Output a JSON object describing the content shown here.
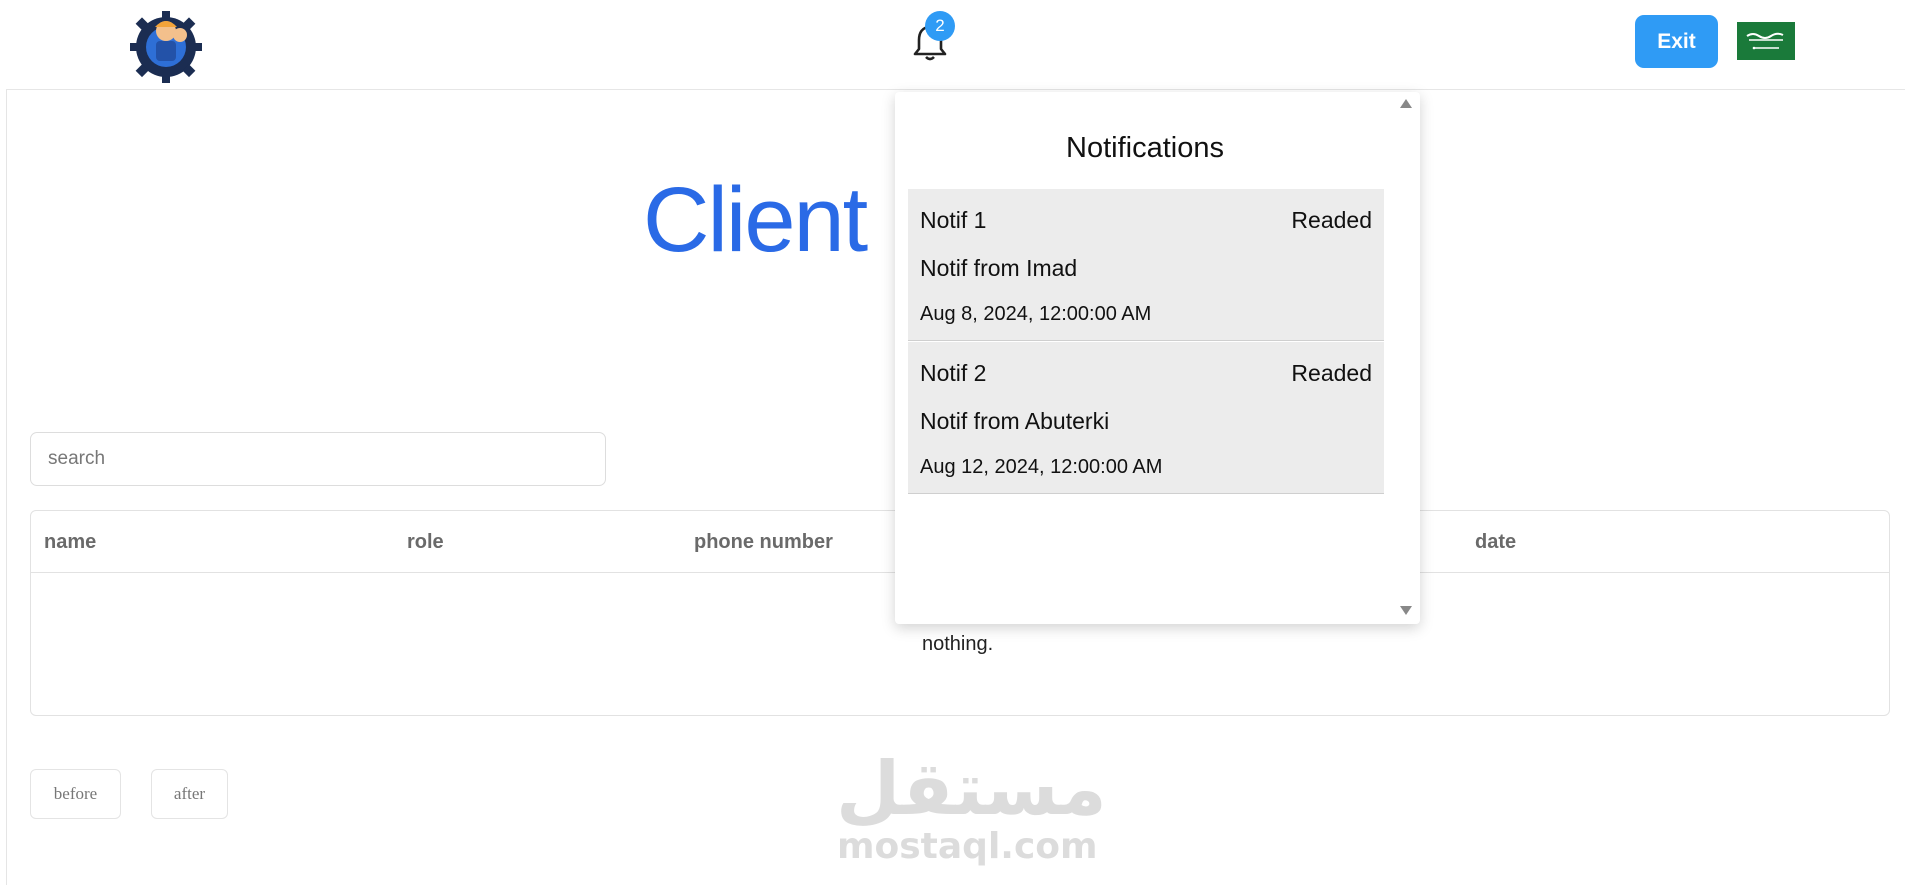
{
  "header": {
    "notification_count": "2",
    "exit_label": "Exit"
  },
  "page": {
    "title": "Client D",
    "search_placeholder": "search"
  },
  "table": {
    "columns": [
      "name",
      "role",
      "phone number",
      "date"
    ],
    "empty_text": "nothing."
  },
  "pagination": {
    "before_label": "before",
    "after_label": "after"
  },
  "watermark": {
    "arabic": "مستقل",
    "latin": "mostaql.com"
  },
  "notifications": {
    "title": "Notifications",
    "items": [
      {
        "title": "Notif 1",
        "status": "Readed",
        "body": "Notif from Imad",
        "date": "Aug 8, 2024, 12:00:00 AM"
      },
      {
        "title": "Notif 2",
        "status": "Readed",
        "body": "Notif from Abuterki",
        "date": "Aug 12, 2024, 12:00:00 AM"
      }
    ]
  },
  "colors": {
    "accent": "#2f9bf5",
    "title_blue": "#2a6ae6",
    "flag_green": "#1a7a3a"
  }
}
